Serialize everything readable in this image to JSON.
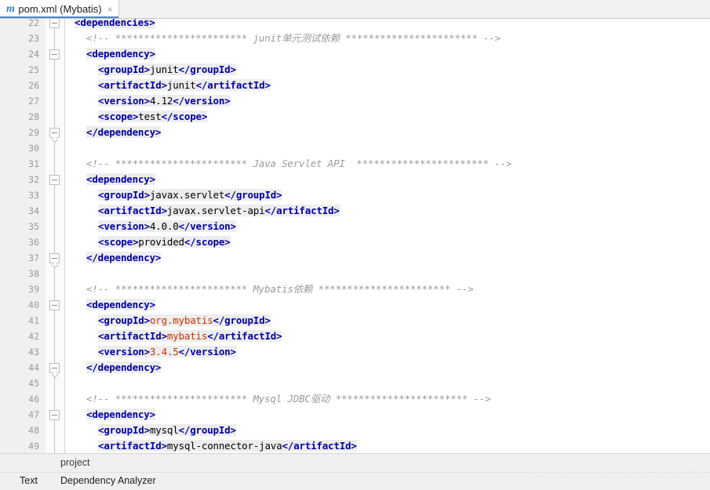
{
  "tab": {
    "icon": "maven-m-icon",
    "label": "pom.xml (Mybatis)",
    "close_icon": "×"
  },
  "editor": {
    "first_line": 22,
    "lines": [
      {
        "no": 22,
        "fold": true,
        "fold_tip": false,
        "indent": 0,
        "clipped": true,
        "parts": [
          {
            "t": "tag",
            "s": "<dependencies>"
          }
        ]
      },
      {
        "no": 23,
        "fold": false,
        "indent": 1,
        "parts": [
          {
            "t": "cmt",
            "s": "<!-- *********************** junit单元测试依赖 *********************** -->"
          }
        ]
      },
      {
        "no": 24,
        "fold": true,
        "fold_tip": false,
        "indent": 1,
        "parts": [
          {
            "t": "tag",
            "s": "<dependency>"
          }
        ]
      },
      {
        "no": 25,
        "fold": false,
        "indent": 2,
        "parts": [
          {
            "t": "tag",
            "s": "<groupId>"
          },
          {
            "t": "txt",
            "s": "junit"
          },
          {
            "t": "tag",
            "s": "</groupId>"
          }
        ]
      },
      {
        "no": 26,
        "fold": false,
        "indent": 2,
        "parts": [
          {
            "t": "tag",
            "s": "<artifactId>"
          },
          {
            "t": "txt",
            "s": "junit"
          },
          {
            "t": "tag",
            "s": "</artifactId>"
          }
        ]
      },
      {
        "no": 27,
        "fold": false,
        "indent": 2,
        "parts": [
          {
            "t": "tag",
            "s": "<version>"
          },
          {
            "t": "txt",
            "s": "4.12"
          },
          {
            "t": "tag",
            "s": "</version>"
          }
        ]
      },
      {
        "no": 28,
        "fold": false,
        "indent": 2,
        "parts": [
          {
            "t": "tag",
            "s": "<scope>"
          },
          {
            "t": "txt",
            "s": "test"
          },
          {
            "t": "tag",
            "s": "</scope>"
          }
        ]
      },
      {
        "no": 29,
        "fold": true,
        "fold_tip": true,
        "indent": 1,
        "parts": [
          {
            "t": "tag",
            "s": "</dependency>"
          }
        ]
      },
      {
        "no": 30,
        "fold": false,
        "indent": 0,
        "parts": []
      },
      {
        "no": 31,
        "fold": false,
        "indent": 1,
        "parts": [
          {
            "t": "cmt",
            "s": "<!-- *********************** Java Servlet API  *********************** -->"
          }
        ]
      },
      {
        "no": 32,
        "fold": true,
        "fold_tip": false,
        "indent": 1,
        "parts": [
          {
            "t": "tag",
            "s": "<dependency>"
          }
        ]
      },
      {
        "no": 33,
        "fold": false,
        "indent": 2,
        "parts": [
          {
            "t": "tag",
            "s": "<groupId>"
          },
          {
            "t": "txt",
            "s": "javax.servlet"
          },
          {
            "t": "tag",
            "s": "</groupId>"
          }
        ]
      },
      {
        "no": 34,
        "fold": false,
        "indent": 2,
        "parts": [
          {
            "t": "tag",
            "s": "<artifactId>"
          },
          {
            "t": "txt",
            "s": "javax.servlet-api"
          },
          {
            "t": "tag",
            "s": "</artifactId>"
          }
        ]
      },
      {
        "no": 35,
        "fold": false,
        "indent": 2,
        "parts": [
          {
            "t": "tag",
            "s": "<version>"
          },
          {
            "t": "txt",
            "s": "4.0.0"
          },
          {
            "t": "tag",
            "s": "</version>"
          }
        ]
      },
      {
        "no": 36,
        "fold": false,
        "indent": 2,
        "parts": [
          {
            "t": "tag",
            "s": "<scope>"
          },
          {
            "t": "txt",
            "s": "provided"
          },
          {
            "t": "tag",
            "s": "</scope>"
          }
        ]
      },
      {
        "no": 37,
        "fold": true,
        "fold_tip": true,
        "indent": 1,
        "parts": [
          {
            "t": "tag",
            "s": "</dependency>"
          }
        ]
      },
      {
        "no": 38,
        "fold": false,
        "indent": 0,
        "parts": []
      },
      {
        "no": 39,
        "fold": false,
        "indent": 1,
        "parts": [
          {
            "t": "cmt",
            "s": "<!-- *********************** Mybatis依赖 *********************** -->"
          }
        ]
      },
      {
        "no": 40,
        "fold": true,
        "fold_tip": false,
        "indent": 1,
        "parts": [
          {
            "t": "tag",
            "s": "<dependency>"
          }
        ]
      },
      {
        "no": 41,
        "fold": false,
        "indent": 2,
        "parts": [
          {
            "t": "tag",
            "s": "<groupId>"
          },
          {
            "t": "val",
            "s": "org.mybatis"
          },
          {
            "t": "tag",
            "s": "</groupId>"
          }
        ]
      },
      {
        "no": 42,
        "fold": false,
        "indent": 2,
        "parts": [
          {
            "t": "tag",
            "s": "<artifactId>"
          },
          {
            "t": "val",
            "s": "mybatis"
          },
          {
            "t": "tag",
            "s": "</artifactId>"
          }
        ]
      },
      {
        "no": 43,
        "fold": false,
        "indent": 2,
        "parts": [
          {
            "t": "tag",
            "s": "<version>"
          },
          {
            "t": "val",
            "s": "3.4.5"
          },
          {
            "t": "tag",
            "s": "</version>"
          }
        ]
      },
      {
        "no": 44,
        "fold": true,
        "fold_tip": true,
        "indent": 1,
        "parts": [
          {
            "t": "tag",
            "s": "</dependency>"
          }
        ]
      },
      {
        "no": 45,
        "fold": false,
        "indent": 0,
        "parts": []
      },
      {
        "no": 46,
        "fold": false,
        "indent": 1,
        "parts": [
          {
            "t": "cmt",
            "s": "<!-- *********************** Mysql JDBC驱动 *********************** -->"
          }
        ]
      },
      {
        "no": 47,
        "fold": true,
        "fold_tip": false,
        "indent": 1,
        "parts": [
          {
            "t": "tag",
            "s": "<dependency>"
          }
        ]
      },
      {
        "no": 48,
        "fold": false,
        "indent": 2,
        "parts": [
          {
            "t": "tag",
            "s": "<groupId>"
          },
          {
            "t": "txt",
            "s": "mysql"
          },
          {
            "t": "tag",
            "s": "</groupId>"
          }
        ]
      },
      {
        "no": 49,
        "fold": false,
        "indent": 2,
        "parts": [
          {
            "t": "tag",
            "s": "<artifactId>"
          },
          {
            "t": "txt",
            "s": "mysql-connector-java"
          },
          {
            "t": "tag",
            "s": "</artifactId>"
          }
        ]
      }
    ]
  },
  "breadcrumb": {
    "item": "project"
  },
  "bottom_tabs": {
    "text": "Text",
    "dependency_analyzer": "Dependency Analyzer"
  },
  "watermark": {
    "text": "https://blog.csdn.net/m0_46699799"
  },
  "colors": {
    "tag": "#0000a5",
    "value_highlight": "#cc3300",
    "comment": "#9a9a9a",
    "tab_accent": "#4a86c8",
    "gutter_bg": "#f0f0f0",
    "code_highlight": "#ededed"
  }
}
